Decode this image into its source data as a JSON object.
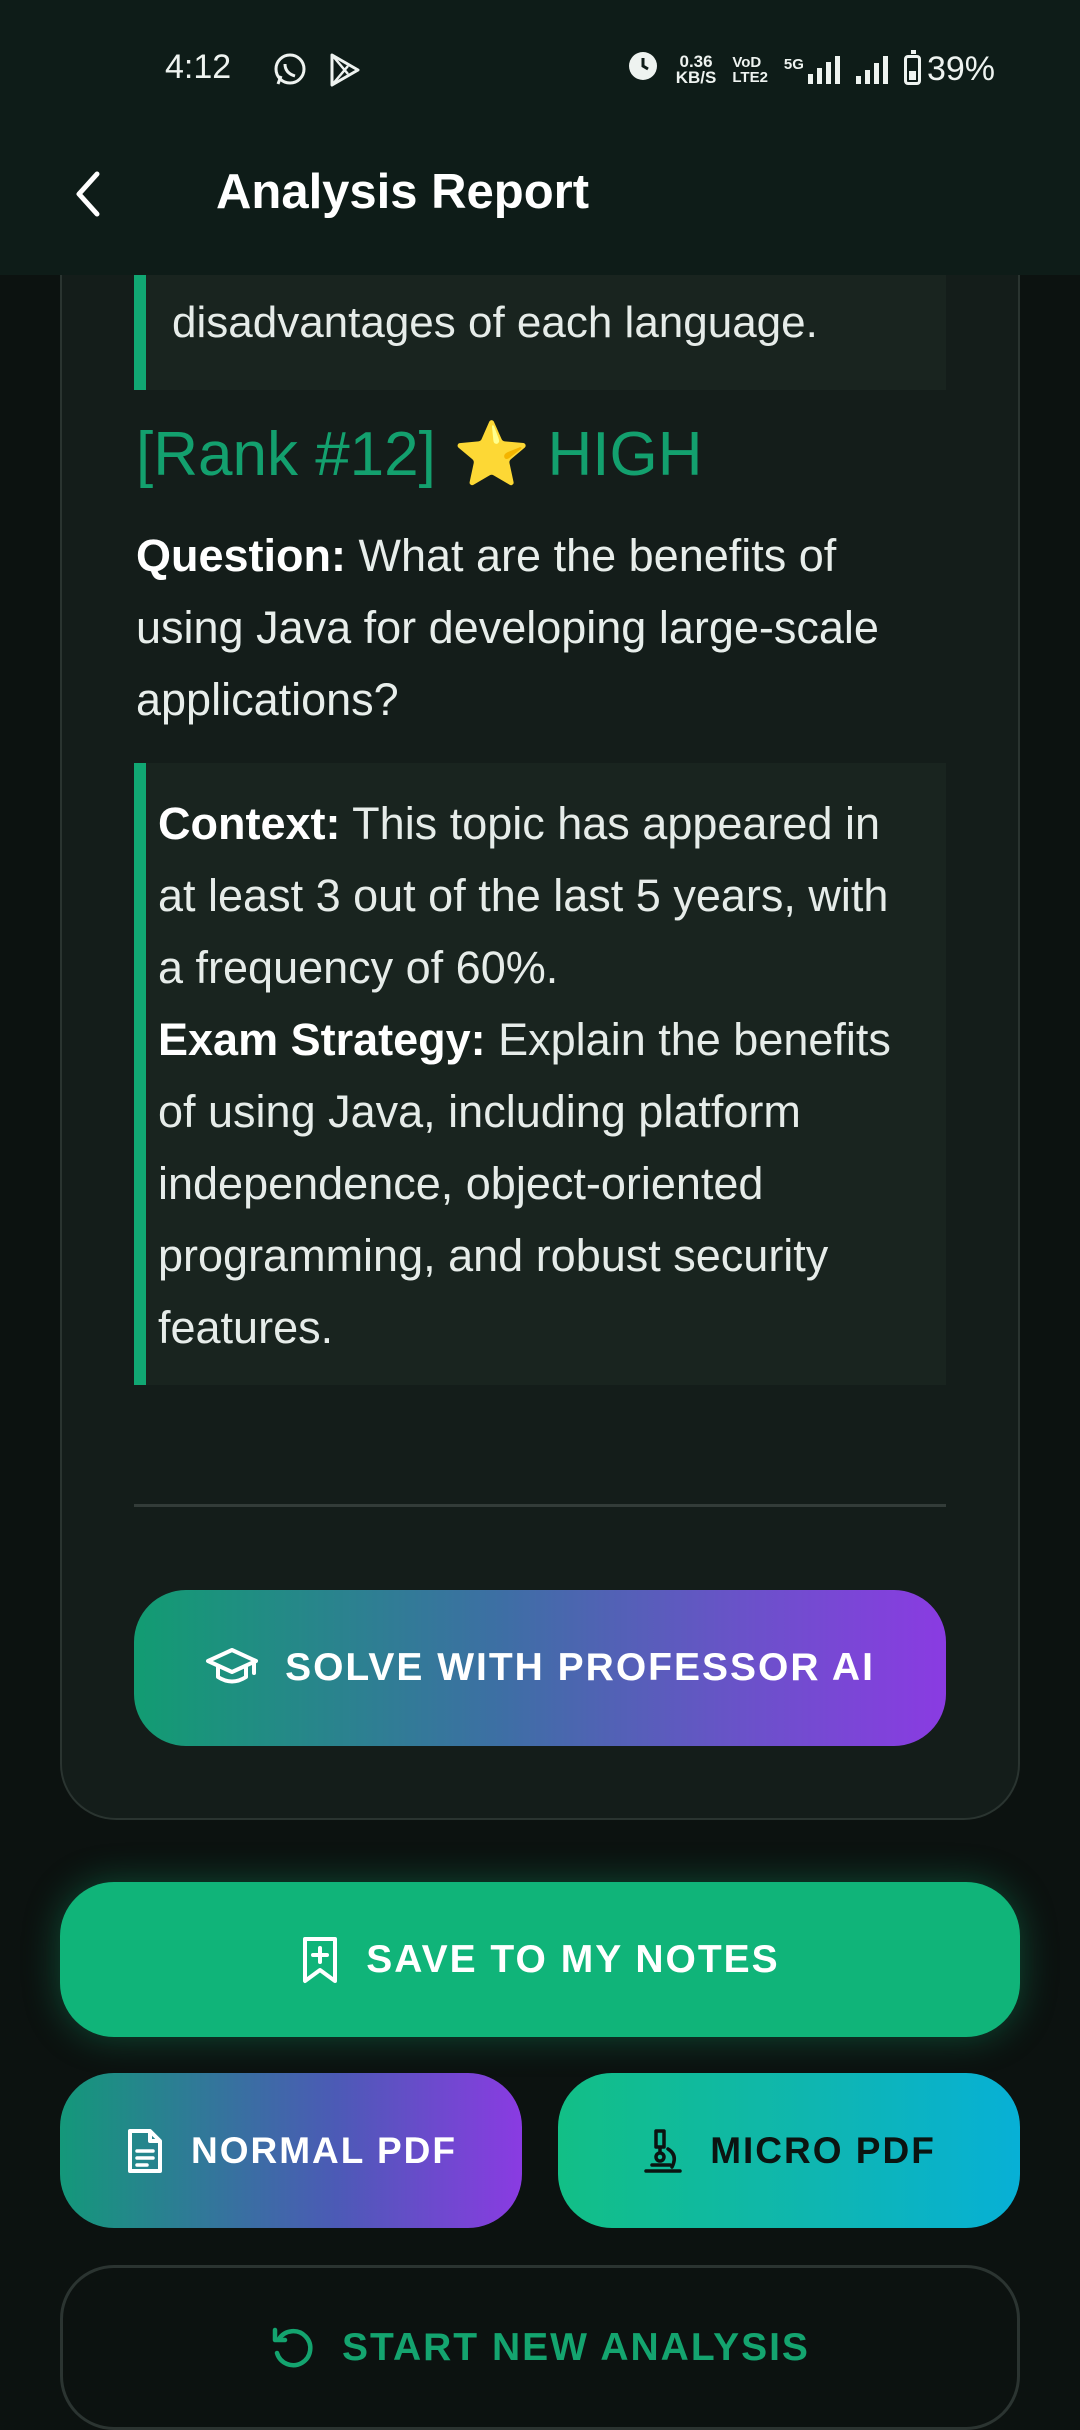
{
  "status_bar": {
    "time": "4:12",
    "net_speed_value": "0.36",
    "net_speed_unit": "KB/S",
    "volte_top": "VoD",
    "volte_bottom": "LTE2",
    "network_type": "5G",
    "battery_percent": "39%",
    "icons": [
      "whatsapp-icon",
      "play-store-icon",
      "alarm-icon",
      "signal-icon",
      "battery-icon"
    ]
  },
  "app_bar": {
    "title": "Analysis Report"
  },
  "previous_item": {
    "partial_line": "disadvantages of each language."
  },
  "item": {
    "rank_label": "[Rank #12]",
    "star": "⭐",
    "priority": "HIGH",
    "question_label": "Question:",
    "question_text": " What are the benefits of using Java for developing large-scale applications?",
    "context_label": "Context:",
    "context_text": " This topic has appeared in at least 3 out of the last 5 years, with a frequency of 60%.",
    "strategy_label": "Exam Strategy:",
    "strategy_text": " Explain the benefits of using Java, including platform independence, object-oriented programming, and robust security features."
  },
  "actions": {
    "solve_label": "SOLVE WITH PROFESSOR AI",
    "save_label": "SAVE TO MY NOTES",
    "normal_pdf_label": "NORMAL PDF",
    "micro_pdf_label": "MICRO PDF",
    "new_analysis_label": "START NEW ANALYSIS"
  },
  "colors": {
    "accent_green": "#10b479",
    "accent_purple": "#8a3be2",
    "accent_cyan": "#07b0d6",
    "background": "#0c1210"
  }
}
